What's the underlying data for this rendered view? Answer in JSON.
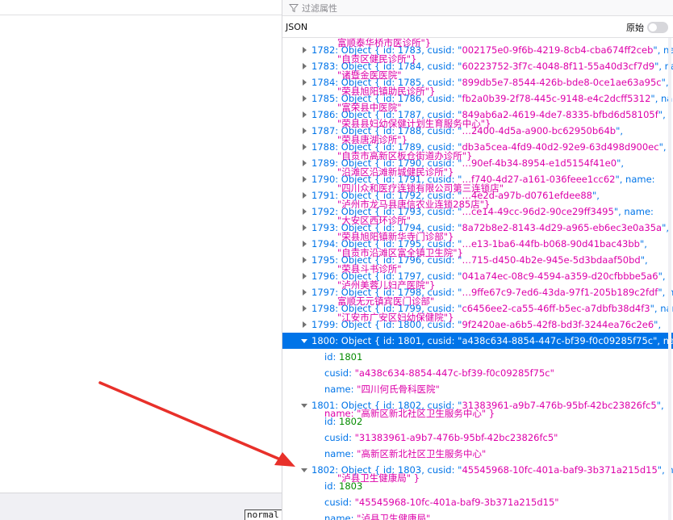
{
  "filter": {
    "placeholder": "过滤属性",
    "icon": "filter-icon"
  },
  "tabs": {
    "json": "JSON",
    "raw_label": "原始"
  },
  "left": {
    "status_text": "normal"
  },
  "colors": {
    "selection": "#0074e8",
    "string": "#dd00a9",
    "number": "#058b00",
    "key": "#0074e8",
    "arrow": "#e8302a"
  },
  "rows": [
    {
      "idx": "1782",
      "id": "1783",
      "cusid": "002175e0-9f6b-4219-8cb4-cba674ff2ceb",
      "tail": ", name:",
      "ghost": "富顺泰华桥市医诊所\"}"
    },
    {
      "idx": "1783",
      "id": "1784",
      "cusid": "60223752-3f7c-4048-8f11-55a40d3cf7d9",
      "tail": ", name:",
      "ghost": "\"自贡区健民诊所\"}"
    },
    {
      "idx": "1784",
      "id": "1785",
      "cusid": "899db5e7-8544-426b-bde8-0ce1ae63a95c",
      "tail": ",",
      "ghost": "\"诸暨金医医院\""
    },
    {
      "idx": "1785",
      "id": "1786",
      "cusid": "fb2a0b39-2f78-445c-9148-e4c2dcff5312",
      "tail": ", name:",
      "ghost": "\"荣县旭阳镇助民诊所\"}"
    },
    {
      "idx": "1786",
      "id": "1787",
      "cusid": "849ab6a2-4619-4de7-8335-bfbd6d58105f",
      "tail": ",",
      "ghost": "\"富荣县中医院\""
    },
    {
      "idx": "1787",
      "id": "1788",
      "cusid": "…2400-4d5a-a900-bc62950b64b",
      "tail": ",",
      "ghost": "\"荣县县妇幼保健计划生育服务中心\"}"
    },
    {
      "idx": "1788",
      "id": "1789",
      "cusid": "db3a5cea-4fd9-40d2-92e9-63d498d900ec",
      "tail": ",",
      "ghost": "\"荣县唐湖诊所\"}"
    },
    {
      "idx": "1789",
      "id": "1790",
      "cusid": "…90ef-4b34-8954-e1d5154f41e0",
      "tail": ",",
      "ghost": "\"自贡市高新区板仓街道办诊所\"}"
    },
    {
      "idx": "1790",
      "id": "1791",
      "cusid": "…f740-4d27-a161-036feee1cc62",
      "tail": ", name:",
      "ghost": "\"沿滩区沿滩新城健民诊所\"}"
    },
    {
      "idx": "1791",
      "id": "1792",
      "cusid": "…4e2d-a97b-d0761efdee88",
      "tail": ",",
      "ghost": "\"四川众和医疗连锁有限公司第三连锁店\""
    },
    {
      "idx": "1792",
      "id": "1793",
      "cusid": "…ce14-49cc-96d2-90ce29ff3495",
      "tail": ", name:",
      "ghost": "\"泸州市龙马县唐信农业连锁285店\"}"
    },
    {
      "idx": "1793",
      "id": "1794",
      "cusid": "8a72b8e2-8143-4d29-a965-eb6ec3e0a35a",
      "tail": ",",
      "ghost": "\"大安区西环诊所\""
    },
    {
      "idx": "1794",
      "id": "1795",
      "cusid": "…e13-1ba6-44fb-b068-90d41bac43bb",
      "tail": ",",
      "ghost": "\"荣县旭阳镇新华寺门诊部\"}"
    },
    {
      "idx": "1795",
      "id": "1796",
      "cusid": "…715-d450-4b2e-945e-5d3bdaaf50bd",
      "tail": ",",
      "ghost": "\"自贡市沿滩区富全镇卫生院\"}"
    },
    {
      "idx": "1796",
      "id": "1797",
      "cusid": "041a74ec-08c9-4594-a359-d20cfbbbe5a6",
      "tail": ",",
      "ghost": "\"荣县斗书诊所\""
    },
    {
      "idx": "1797",
      "id": "1798",
      "cusid": "…9ffe67c9-7ed6-43da-97f1-205b189c2fdf",
      "tail": ", name: \"",
      "ghost": "\"泸州美蓉儿妇产医院\"}"
    },
    {
      "idx": "1798",
      "id": "1799",
      "cusid": "c6456ee2-ca55-46ff-b5ec-a7dbfb38d4f3",
      "tail": ", name:",
      "ghost": "富顺无元镇宾医门诊部\""
    },
    {
      "idx": "1799",
      "id": "1800",
      "cusid": "9f2420ae-a6b5-42f8-bd3f-3244ea76c2e6",
      "tail": ",",
      "ghost": "\"江安市广安区妇幼保健院\"}"
    }
  ],
  "selected": {
    "idx": "1800",
    "id": "1801",
    "cusid": "a438c634-8854-447c-bf39-f0c09285f75c",
    "tail": ", name:",
    "props": {
      "id": "1801",
      "cusid": "\"a438c634-8854-447c-bf39-f0c09285f75c\"",
      "name": "\"四川何氏骨科医院\""
    }
  },
  "expanded2": {
    "idx": "1801",
    "id": "1802",
    "cusid": "31383961-a9b7-476b-95bf-42bc23826fc5",
    "tail": ",",
    "ghost": "name: \"高新区新北社区卫生服务中心\" }",
    "props": {
      "id": "1802",
      "cusid": "\"31383961-a9b7-476b-95bf-42bc23826fc5\"",
      "name": "\"高新区新北社区卫生服务中心\""
    }
  },
  "expanded3": {
    "idx": "1802",
    "id": "1803",
    "cusid": "45545968-10fc-401a-baf9-3b371a215d15",
    "tail": ", name:",
    "ghost": "\"泸县卫生健康局\" }",
    "props": {
      "id": "1803",
      "cusid": "\"45545968-10fc-401a-baf9-3b371a215d15\"",
      "name": "\"泸县卫生健康局\""
    }
  }
}
